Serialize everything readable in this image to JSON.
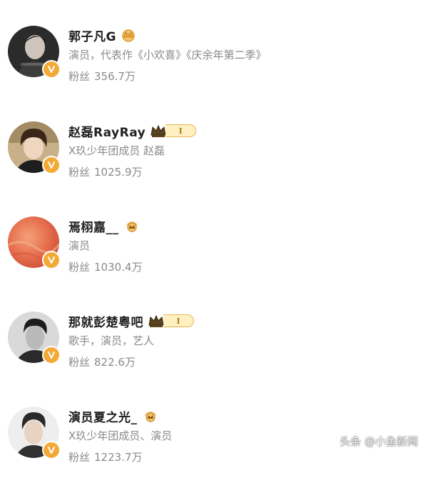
{
  "fans_label": "粉丝",
  "colors": {
    "name": "#1f1f1f",
    "meta": "#8a8a8a",
    "verified_badge": "#f3a935",
    "crown": "#e9a83a"
  },
  "users": [
    {
      "name": "郭子凡G",
      "description": "演员，代表作《小欢喜》《庆余年第二季》",
      "fans": "356.7万",
      "level": "",
      "avatar_icon": "avatar-photo-man-dark",
      "crown_icon": "crown-icon"
    },
    {
      "name": "赵磊RayRay",
      "description": "X玖少年团成员 赵磊",
      "fans": "1025.9万",
      "level": "I",
      "avatar_icon": "avatar-photo-man-hair",
      "crown_icon": "crown-icon"
    },
    {
      "name": "焉栩嘉__",
      "description": "演员",
      "fans": "1030.4万",
      "level": "",
      "avatar_icon": "avatar-orange-texture",
      "crown_icon": "crown-icon"
    },
    {
      "name": "那就彭楚粤吧",
      "description": "歌手，演员，艺人",
      "fans": "822.6万",
      "level": "I",
      "avatar_icon": "avatar-photo-man-bw",
      "crown_icon": "crown-icon"
    },
    {
      "name": "演员夏之光_",
      "description": "X玖少年团成员、演员",
      "fans": "1223.7万",
      "level": "",
      "avatar_icon": "avatar-photo-man-light",
      "crown_icon": "crown-icon"
    }
  ],
  "watermark": "头条 @小鱼新闻"
}
